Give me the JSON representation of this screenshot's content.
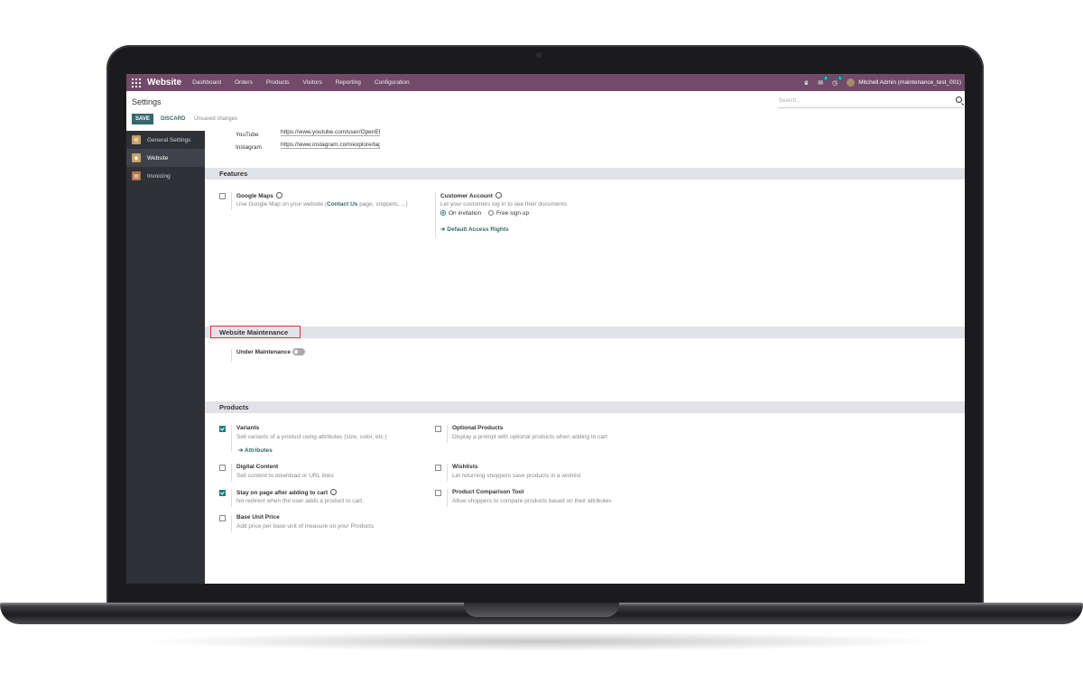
{
  "navbar": {
    "app_name": "Website",
    "menu": [
      "Dashboard",
      "Orders",
      "Products",
      "Visitors",
      "Reporting",
      "Configuration"
    ],
    "messages_count": "4",
    "activities_count": "1",
    "user": "Mitchell Admin (maintenance_test_001)"
  },
  "control_panel": {
    "title": "Settings",
    "save_label": "SAVE",
    "discard_label": "DISCARD",
    "status": "Unsaved changes",
    "search_placeholder": "Search..."
  },
  "sidebar": {
    "items": [
      {
        "label": "General Settings",
        "icon": "settings-icon",
        "color": "#c8a060"
      },
      {
        "label": "Website",
        "icon": "website-icon",
        "color": "#c8a060"
      },
      {
        "label": "Invoicing",
        "icon": "invoicing-icon",
        "color": "#b6734e"
      }
    ]
  },
  "social": {
    "youtube_label": "YouTube",
    "youtube_value": "https://www.youtube.com/user/OpenERPonline",
    "instagram_label": "Instagram",
    "instagram_value": "https://www.instagram.com/explore/tags/odoo/"
  },
  "features": {
    "section_title": "Features",
    "google_maps": {
      "title": "Google Maps",
      "desc_before": "Use Google Map on your website (",
      "desc_link": "Contact Us",
      "desc_after": " page, snippets, ...)",
      "checked": false
    },
    "customer_account": {
      "title": "Customer Account",
      "desc": "Let your customers log in to see their documents",
      "option_invitation": "On invitation",
      "option_signup": "Free sign up",
      "selected": "On invitation",
      "link": "Default Access Rights"
    }
  },
  "maintenance": {
    "section_title": "Website Maintenance",
    "under_maintenance": "Under Maintenance",
    "enabled": false
  },
  "products": {
    "section_title": "Products",
    "left": [
      {
        "title": "Variants",
        "desc": "Sell variants of a product using attributes (size, color, etc.)",
        "checked": true,
        "link": "Attributes"
      },
      {
        "title": "Digital Content",
        "desc": "Sell content to download or URL links",
        "checked": false
      },
      {
        "title": "Stay on page after adding to cart",
        "desc": "No redirect when the user adds a product to cart.",
        "checked": true
      },
      {
        "title": "Base Unit Price",
        "desc": "Add price per base unit of measure on your Products",
        "checked": false
      }
    ],
    "right": [
      {
        "title": "Optional Products",
        "desc": "Display a prompt with optional products when adding to cart",
        "checked": false
      },
      {
        "title": "Wishlists",
        "desc": "Let returning shoppers save products in a wishlist",
        "checked": false
      },
      {
        "title": "Product Comparison Tool",
        "desc": "Allow shoppers to compare products based on their attributes",
        "checked": false
      }
    ]
  },
  "colors": {
    "navbar": "#714b67",
    "primary": "#35686e",
    "highlight_border": "#d9353e"
  }
}
